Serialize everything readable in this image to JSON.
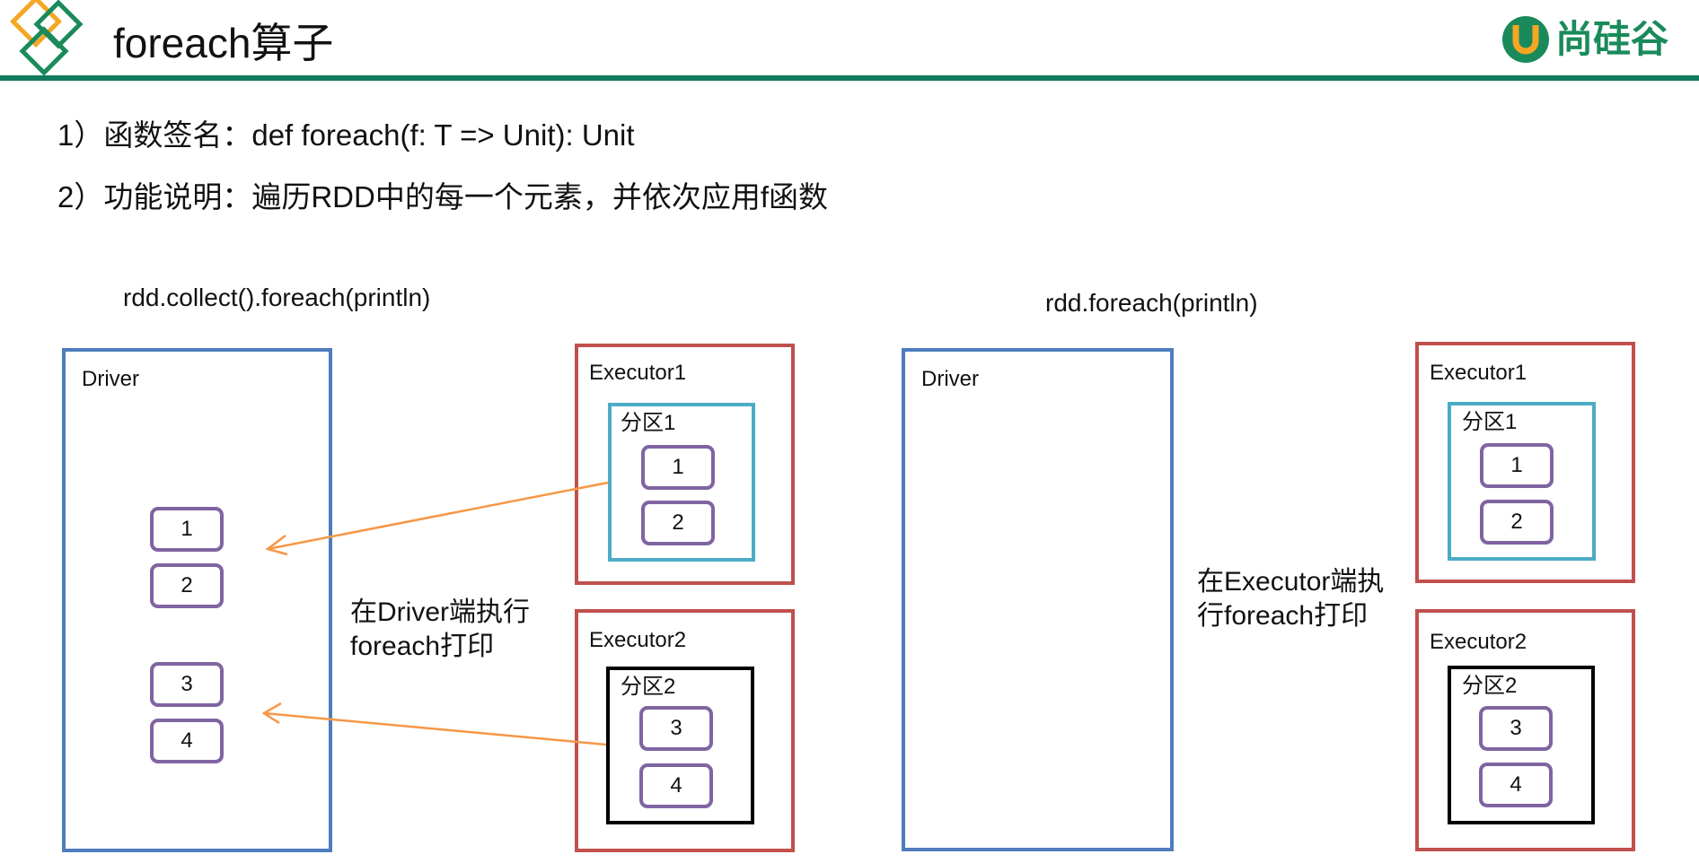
{
  "title": "foreach算子",
  "logo_text": "尚硅谷",
  "bullets": [
    "1）函数签名：def foreach(f: T => Unit): Unit",
    "2）功能说明：遍历RDD中的每一个元素，并依次应用f函数"
  ],
  "left_panel": {
    "code_caption": "rdd.collect().foreach(println)",
    "driver_label": "Driver",
    "driver_items": [
      "1",
      "2",
      "3",
      "4"
    ],
    "note": "在Driver端执行\nforeach打印",
    "executors": [
      {
        "label": "Executor1",
        "partition": "分区1",
        "items": [
          "1",
          "2"
        ]
      },
      {
        "label": "Executor2",
        "partition": "分区2",
        "items": [
          "3",
          "4"
        ]
      }
    ]
  },
  "right_panel": {
    "code_caption": "rdd.foreach(println)",
    "driver_label": "Driver",
    "note": "在Executor端执\n行foreach打印",
    "executors": [
      {
        "label": "Executor1",
        "partition": "分区1",
        "items": [
          "1",
          "2"
        ]
      },
      {
        "label": "Executor2",
        "partition": "分区2",
        "items": [
          "3",
          "4"
        ]
      }
    ]
  },
  "colors": {
    "header_rule": "#127a5e",
    "driver_border": "#4e7cbd",
    "executor_border": "#c0504d",
    "partition1_border": "#4bacc6",
    "partition2_border": "#000000",
    "item_border": "#8064a2",
    "arrow": "#f79646",
    "logo_green": "#1a8a5a",
    "logo_orange": "#f5a623"
  }
}
